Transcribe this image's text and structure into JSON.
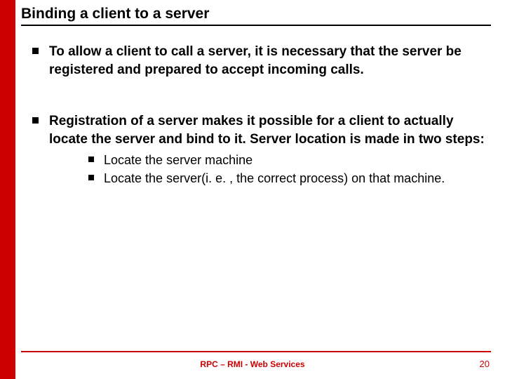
{
  "title": "Binding a client to a server",
  "bullets": [
    {
      "text": "To allow a client to call a server, it is necessary that the server be registered and prepared to accept incoming calls."
    },
    {
      "text": "Registration of a server makes it possible for a client to actually locate the server and bind to it. Server location is made in two steps:",
      "sub": [
        "Locate the server machine",
        "Locate the server(i. e. , the correct process) on that machine."
      ]
    }
  ],
  "footer_center": "RPC – RMI - Web Services",
  "footer_page": "20"
}
